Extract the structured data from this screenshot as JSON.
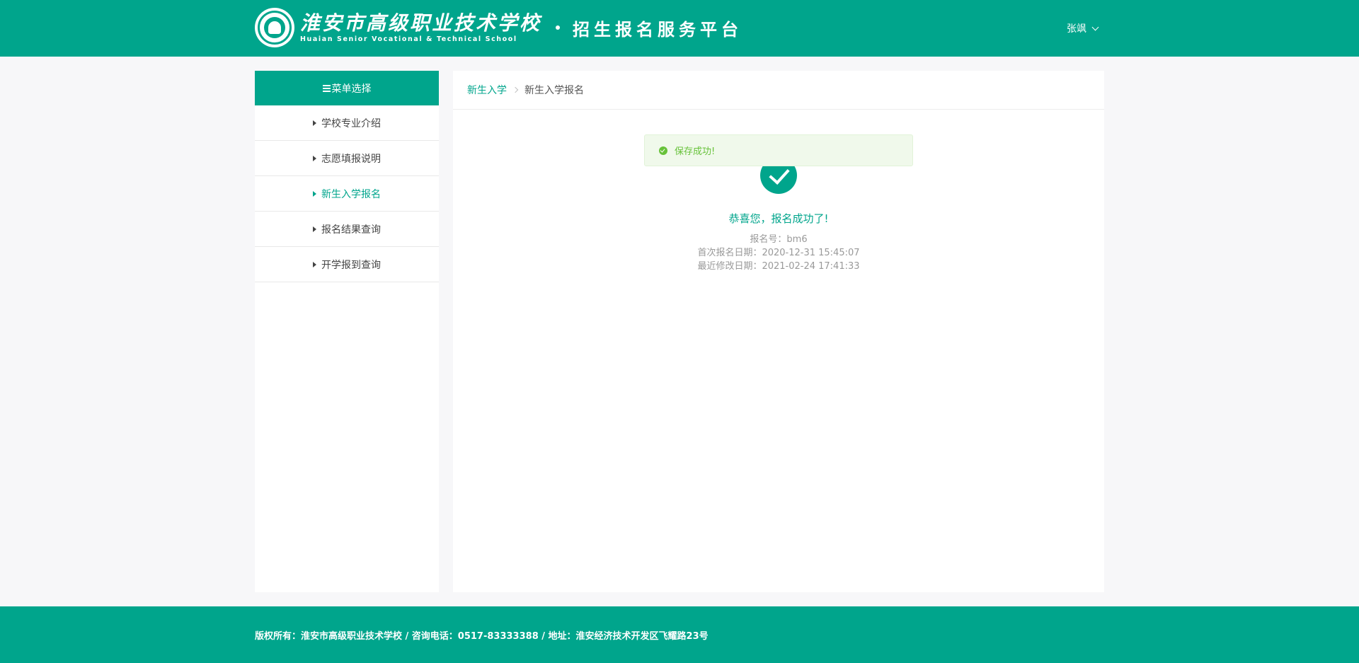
{
  "header": {
    "school_name_cn": "淮安市高级职业技术学校",
    "school_name_en": "Huaian Senior Vocational & Technical School",
    "platform_title": "招生报名服务平台",
    "user_name": "张飒"
  },
  "sidebar": {
    "header_label": "菜单选择",
    "items": [
      {
        "label": "学校专业介绍",
        "active": false
      },
      {
        "label": "志愿填报说明",
        "active": false
      },
      {
        "label": "新生入学报名",
        "active": true
      },
      {
        "label": "报名结果查询",
        "active": false
      },
      {
        "label": "开学报到查询",
        "active": false
      }
    ]
  },
  "breadcrumb": {
    "parent": "新生入学",
    "current": "新生入学报名"
  },
  "toast": {
    "message": "保存成功!"
  },
  "result": {
    "title": "恭喜您，报名成功了!",
    "registration_no": "报名号：bm6",
    "first_date": "首次报名日期：2020-12-31 15:45:07",
    "modified_date": "最近修改日期：2021-02-24 17:41:33"
  },
  "footer": {
    "text": "版权所有：淮安市高级职业技术学校 / 咨询电话：0517-83333388 / 地址：淮安经济技术开发区飞耀路23号"
  },
  "colors": {
    "brand": "#00a58c",
    "toast_green": "#67c23a",
    "toast_bg": "#f0f9eb"
  }
}
